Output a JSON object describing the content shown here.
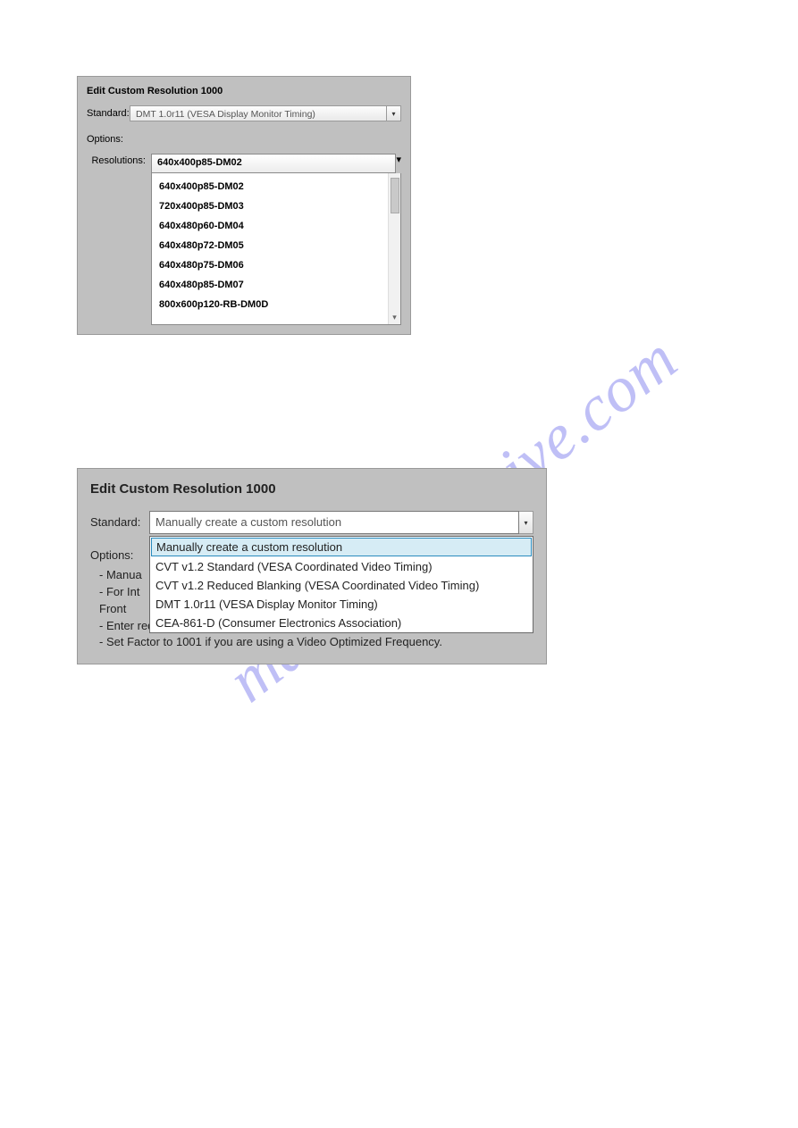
{
  "watermark": "manualsarchive.com",
  "panel1": {
    "title": "Edit Custom Resolution 1000",
    "standard_label": "Standard:",
    "standard_value": "DMT 1.0r11 (VESA Display Monitor Timing)",
    "options_label": "Options:",
    "resolutions_label": "Resolutions:",
    "resolutions_selected": "640x400p85-DM02",
    "resolutions_list": [
      "640x400p85-DM02",
      "720x400p85-DM03",
      "640x480p60-DM04",
      "640x480p72-DM05",
      "640x480p75-DM06",
      "640x480p85-DM07",
      "800x600p120-RB-DM0D"
    ]
  },
  "panel2": {
    "title": "Edit Custom Resolution 1000",
    "standard_label": "Standard:",
    "standard_value": "Manually create a custom resolution",
    "standard_options": [
      "Manually create a custom resolution",
      "CVT v1.2 Standard (VESA Coordinated Video Timing)",
      "CVT v1.2 Reduced Blanking (VESA Coordinated Video Timing)",
      "DMT 1.0r11 (VESA Display Monitor Timing)",
      "CEA-861-D (Consumer Electronics Association)"
    ],
    "options_label": "Options:",
    "bullets": [
      "- Manua",
      "- For Int",
      "  Front",
      "- Enter required Pixel clock, Horizontal, or Vertical Frequency.",
      "- Set Factor to 1001 if you are using a Video Optimized Frequency."
    ]
  }
}
